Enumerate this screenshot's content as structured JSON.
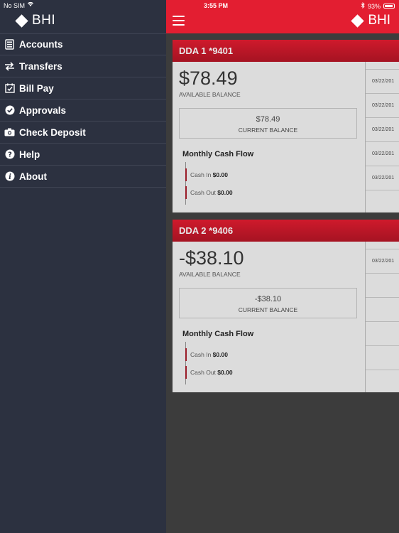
{
  "status_bar": {
    "carrier": "No SIM",
    "time": "3:55 PM",
    "battery": "93%",
    "battery_level": 0.93
  },
  "sidebar": {
    "brand": "BHI",
    "items": [
      {
        "label": "Accounts",
        "icon": "accounts-icon"
      },
      {
        "label": "Transfers",
        "icon": "transfers-icon"
      },
      {
        "label": "Bill Pay",
        "icon": "calendar-check-icon"
      },
      {
        "label": "Approvals",
        "icon": "check-circle-icon"
      },
      {
        "label": "Check Deposit",
        "icon": "camera-icon"
      },
      {
        "label": "Help",
        "icon": "question-icon"
      },
      {
        "label": "About",
        "icon": "info-icon"
      }
    ]
  },
  "header": {
    "brand": "BHI"
  },
  "accounts": [
    {
      "name": "DDA 1 *9401",
      "available_balance": "$78.49",
      "available_label": "AVAILABLE BALANCE",
      "current_balance": "$78.49",
      "current_label": "CURRENT BALANCE",
      "cash_flow_title": "Monthly Cash Flow",
      "cash_in_label": "Cash In",
      "cash_in_value": "$0.00",
      "cash_out_label": "Cash Out",
      "cash_out_value": "$0.00",
      "transaction_dates": [
        "03/22/201",
        "03/22/201",
        "03/22/201",
        "03/22/201",
        "03/22/201"
      ]
    },
    {
      "name": "DDA 2 *9406",
      "available_balance": "-$38.10",
      "available_label": "AVAILABLE BALANCE",
      "current_balance": "-$38.10",
      "current_label": "CURRENT BALANCE",
      "cash_flow_title": "Monthly Cash Flow",
      "cash_in_label": "Cash In",
      "cash_in_value": "$0.00",
      "cash_out_label": "Cash Out",
      "cash_out_value": "$0.00",
      "transaction_dates": [
        "03/22/201",
        "",
        "",
        "",
        ""
      ]
    }
  ],
  "colors": {
    "brand_red": "#e31e31",
    "sidebar_bg": "#2c3140",
    "card_bg": "#dcdcdc"
  }
}
